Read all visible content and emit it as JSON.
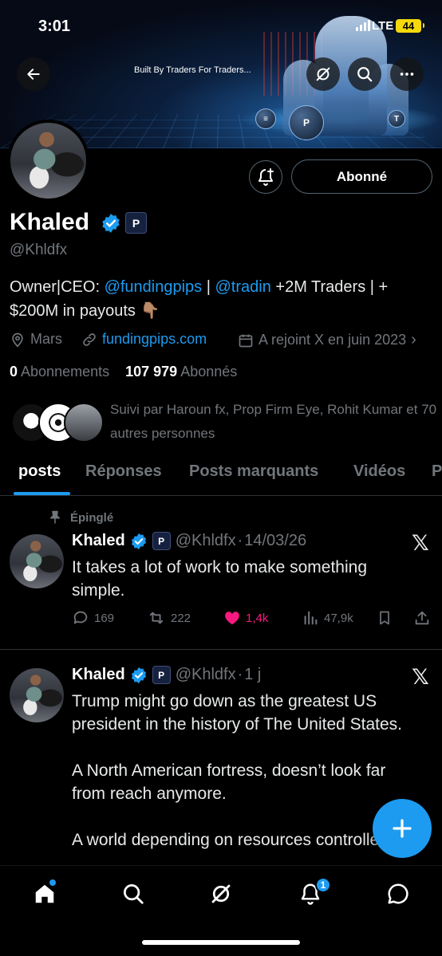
{
  "status_bar": {
    "time": "3:01",
    "network": "LTE",
    "battery": "44"
  },
  "banner": {
    "tagline": "Built By Traders For Traders..."
  },
  "profile": {
    "name": "Khaled",
    "handle": "@Khldfx",
    "follow_button": "Abonné",
    "bio": {
      "prefix": "Owner|CEO: ",
      "mention1": "@fundingpips",
      "sep": " | ",
      "mention2": "@tradin",
      "suffix": " +2M Traders | + $200M in payouts 👇🏽"
    },
    "location": "Mars",
    "website": "fundingpips.com",
    "joined": "A rejoint X en juin 2023",
    "following_count": "0",
    "following_label": "Abonnements",
    "followers_count": "107 979",
    "followers_label": "Abonnés",
    "followed_by": "Suivi par Haroun fx, Prop Firm Eye, Rohit Kumar et 70 autres personnes"
  },
  "tabs": [
    {
      "label": "posts",
      "active": true
    },
    {
      "label": "Réponses"
    },
    {
      "label": "Posts marquants"
    },
    {
      "label": "Vidéos"
    },
    {
      "label": "P"
    }
  ],
  "posts": [
    {
      "pinned_label": "Épinglé",
      "name": "Khaled",
      "handle": "@Khldfx",
      "sep": "·",
      "time": "14/03/26",
      "text": "It takes a lot of work to make something simple.",
      "replies": "169",
      "reposts": "222",
      "likes": "1,4k",
      "views": "47,9k"
    },
    {
      "name": "Khaled",
      "handle": "@Khldfx",
      "sep": "·",
      "time": "1 j",
      "text_p1": "Trump might go down as the greatest US president in the history of The United States.",
      "text_p2": "A North American fortress, doesn’t look far from reach anymore.",
      "text_p3": "A world depending on resources controlled"
    }
  ],
  "nav": {
    "notifications_badge": "1"
  },
  "colors": {
    "accent": "#1d9bf0",
    "like": "#f91880",
    "muted": "#71767b",
    "battery": "#f5d90a"
  }
}
